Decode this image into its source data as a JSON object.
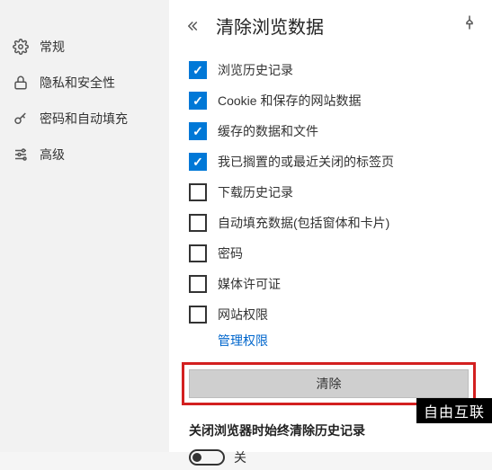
{
  "sidebar": {
    "items": [
      {
        "label": "常规",
        "icon": "gear"
      },
      {
        "label": "隐私和安全性",
        "icon": "lock"
      },
      {
        "label": "密码和自动填充",
        "icon": "key"
      },
      {
        "label": "高级",
        "icon": "sliders"
      }
    ]
  },
  "header": {
    "title": "清除浏览数据"
  },
  "options": [
    {
      "label": "浏览历史记录",
      "checked": true
    },
    {
      "label": "Cookie 和保存的网站数据",
      "checked": true
    },
    {
      "label": "缓存的数据和文件",
      "checked": true
    },
    {
      "label": "我已搁置的或最近关闭的标签页",
      "checked": true
    },
    {
      "label": "下载历史记录",
      "checked": false
    },
    {
      "label": "自动填充数据(包括窗体和卡片)",
      "checked": false
    },
    {
      "label": "密码",
      "checked": false
    },
    {
      "label": "媒体许可证",
      "checked": false
    },
    {
      "label": "网站权限",
      "checked": false
    }
  ],
  "manage_link": "管理权限",
  "clear_button": "清除",
  "always_clear": {
    "title": "关闭浏览器时始终清除历史记录",
    "toggle_state": "关"
  },
  "watermark": "自由互联"
}
